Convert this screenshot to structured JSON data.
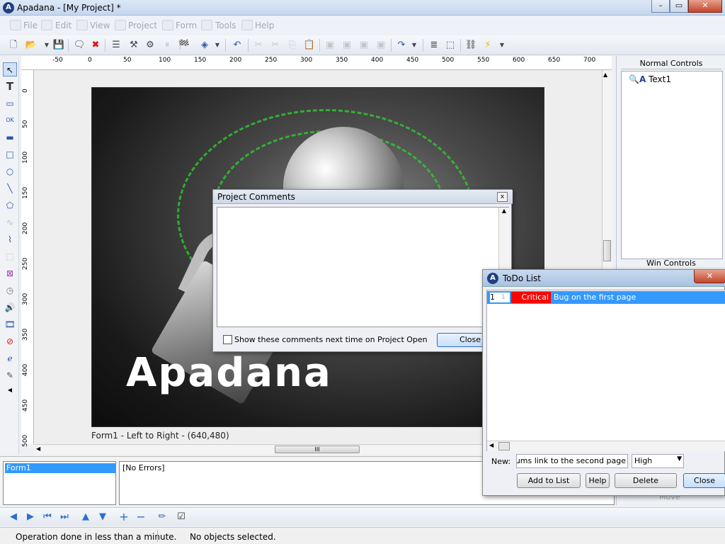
{
  "window": {
    "title": "Apadana - [My Project] *",
    "min": "–",
    "max": "▭",
    "close": "✕"
  },
  "menu": [
    "File",
    "Edit",
    "View",
    "Project",
    "Form",
    "Tools",
    "Help"
  ],
  "ruler": {
    "h_ticks": [
      "-50",
      "0",
      "50",
      "100",
      "150",
      "200",
      "250",
      "300",
      "350",
      "400",
      "450",
      "500",
      "550",
      "600",
      "650",
      "700"
    ],
    "v_ticks": [
      "0",
      "50",
      "100",
      "150",
      "200",
      "250",
      "300",
      "350",
      "400",
      "450",
      "500"
    ]
  },
  "canvas": {
    "brand_text": "Apadana",
    "caption": "Form1 - Left to Right - (640,480)"
  },
  "scroll": {
    "thumb_grip": "III",
    "up": "▲",
    "left": "◀",
    "right": "▶"
  },
  "right_panel": {
    "normal_controls": "Normal Controls",
    "item": "Text1",
    "win_controls": "Win Controls",
    "move": "Move"
  },
  "bottom": {
    "form_item": "Form1",
    "errors": "[No Errors]"
  },
  "status": {
    "left": "Operation done in less than a minute.",
    "right": "No objects selected."
  },
  "comments_dialog": {
    "title": "Project Comments",
    "close_x": "x",
    "checkbox_label": "Show these comments next time on Project Open",
    "close_button": "Close"
  },
  "todo_dialog": {
    "title": "ToDo List",
    "close_x": "✕",
    "row": {
      "index": "1",
      "count": "1",
      "priority": "Critical",
      "text": "Bug on the first page"
    },
    "new_label": "New:",
    "new_value": "a forums link to the second page",
    "priority_value": "High",
    "buttons": {
      "add": "Add to List",
      "help": "Help",
      "delete": "Delete",
      "close": "Close"
    }
  },
  "colors": {
    "accent": "#3399ff",
    "critical": "#ff0000",
    "titlebar": "#c4d6ee"
  }
}
